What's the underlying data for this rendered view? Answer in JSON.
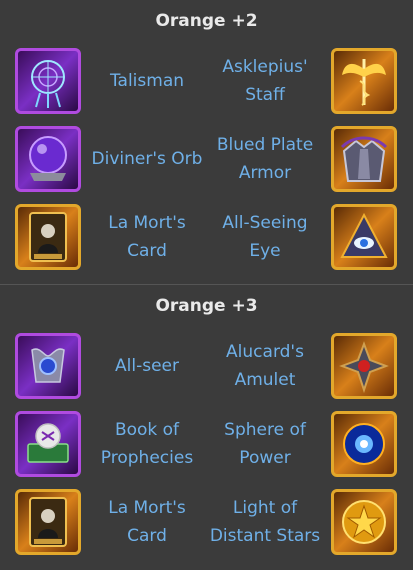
{
  "sections": [
    {
      "title": "Orange +2",
      "rows": [
        {
          "left": {
            "name": "Talisman",
            "icon": "dreamcatcher-talisman-icon",
            "frame": "purple"
          },
          "right": {
            "name": "Asklepius'\nStaff",
            "icon": "winged-staff-icon",
            "frame": "gold"
          }
        },
        {
          "left": {
            "name": "Diviner's Orb",
            "icon": "crystal-orb-icon",
            "frame": "purple"
          },
          "right": {
            "name": "Blued Plate\nArmor",
            "icon": "plate-armor-icon",
            "frame": "gold"
          }
        },
        {
          "left": {
            "name": "La Mort's\nCard",
            "icon": "death-tarot-card-icon",
            "frame": "gold"
          },
          "right": {
            "name": "All-Seeing\nEye",
            "icon": "pyramid-eye-icon",
            "frame": "gold"
          }
        }
      ]
    },
    {
      "title": "Orange +3",
      "rows": [
        {
          "left": {
            "name": "All-seer",
            "icon": "winged-eye-orb-icon",
            "frame": "purple"
          },
          "right": {
            "name": "Alucard's\nAmulet",
            "icon": "spiked-amulet-icon",
            "frame": "gold"
          }
        },
        {
          "left": {
            "name": "Book of\nProphecies",
            "icon": "prophecy-book-icon",
            "frame": "purple"
          },
          "right": {
            "name": "Sphere of\nPower",
            "icon": "power-sphere-icon",
            "frame": "gold"
          }
        },
        {
          "left": {
            "name": "La Mort's\nCard",
            "icon": "death-tarot-card-icon",
            "frame": "gold"
          },
          "right": {
            "name": "Light of\nDistant Stars",
            "icon": "golden-star-coin-icon",
            "frame": "gold"
          }
        }
      ]
    }
  ],
  "colors": {
    "background": "#3b3b3b",
    "title": "#e9e9e9",
    "item_text": "#6fb0e8",
    "purple_frame": "#b04be0",
    "gold_frame": "#e3a82b"
  }
}
